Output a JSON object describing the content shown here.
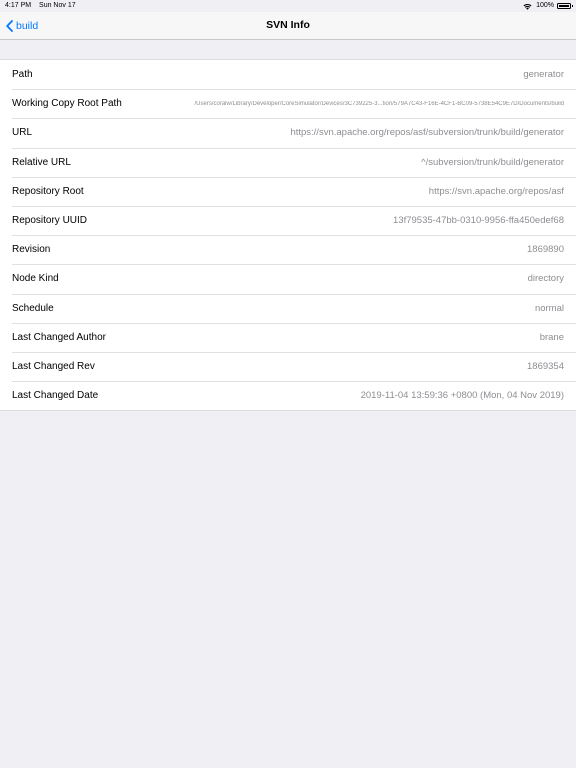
{
  "status_bar": {
    "time": "4:17 PM",
    "date": "Sun Nov 17",
    "battery": "100%"
  },
  "nav": {
    "back_label": "build",
    "title": "SVN Info"
  },
  "rows": [
    {
      "key": "Path",
      "value": "generator"
    },
    {
      "key": "Working Copy Root Path",
      "value": "/Users/coralw/Library/Developer/CoreSimulator/Devices/3C739225-3...tion/579A7C43-F16E-4CF1-BC09-5738E54C9E7D/Documents/build"
    },
    {
      "key": "URL",
      "value": "https://svn.apache.org/repos/asf/subversion/trunk/build/generator"
    },
    {
      "key": "Relative URL",
      "value": "^/subversion/trunk/build/generator"
    },
    {
      "key": "Repository Root",
      "value": "https://svn.apache.org/repos/asf"
    },
    {
      "key": "Repository UUID",
      "value": "13f79535-47bb-0310-9956-ffa450edef68"
    },
    {
      "key": "Revision",
      "value": "1869890"
    },
    {
      "key": "Node Kind",
      "value": "directory"
    },
    {
      "key": "Schedule",
      "value": "normal"
    },
    {
      "key": "Last Changed Author",
      "value": "brane"
    },
    {
      "key": "Last Changed Rev",
      "value": "1869354"
    },
    {
      "key": "Last Changed Date",
      "value": "2019-11-04 13:59:36 +0800 (Mon, 04 Nov 2019)"
    }
  ],
  "colors": {
    "accent": "#007aff",
    "background": "#efeff4",
    "secondary_text": "#8e8e93"
  },
  "icons": {
    "back": "chevron-left-icon",
    "wifi": "wifi-icon",
    "battery": "battery-icon"
  }
}
